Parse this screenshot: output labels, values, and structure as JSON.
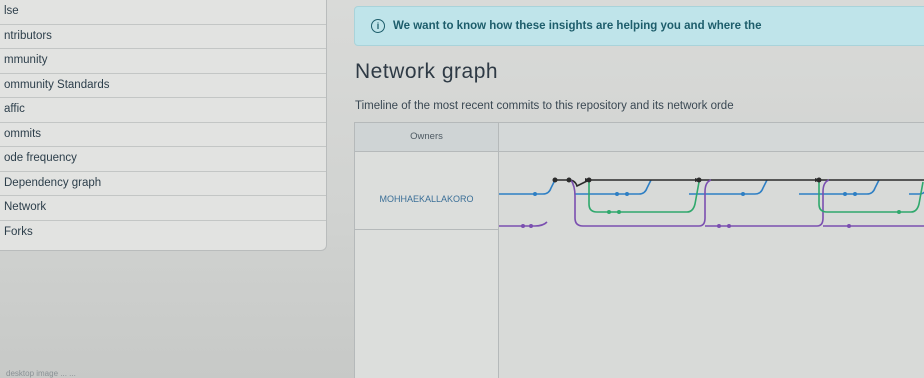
{
  "sidebar": {
    "items": [
      {
        "label": "lse"
      },
      {
        "label": "ntributors"
      },
      {
        "label": "mmunity"
      },
      {
        "label": "ommunity Standards"
      },
      {
        "label": "affic"
      },
      {
        "label": "ommits"
      },
      {
        "label": "ode frequency"
      },
      {
        "label": "Dependency graph"
      },
      {
        "label": "Network"
      },
      {
        "label": "Forks"
      }
    ]
  },
  "banner": {
    "icon": "info-icon",
    "text": "We want to know how these insights are helping you and where the"
  },
  "main": {
    "title": "Network graph",
    "subtitle": "Timeline of the most recent commits to this repository and its network orde"
  },
  "graph": {
    "owners_header": "Owners",
    "owners": [
      {
        "name": "MOHHAEKALLAKORO"
      }
    ],
    "colors": {
      "primary": "#2e7fc4",
      "secondary": "#2fa86c",
      "tertiary": "#7b4fb0",
      "commit": "#2b2b2b"
    }
  },
  "footer": {
    "text": "desktop image ... ..."
  }
}
